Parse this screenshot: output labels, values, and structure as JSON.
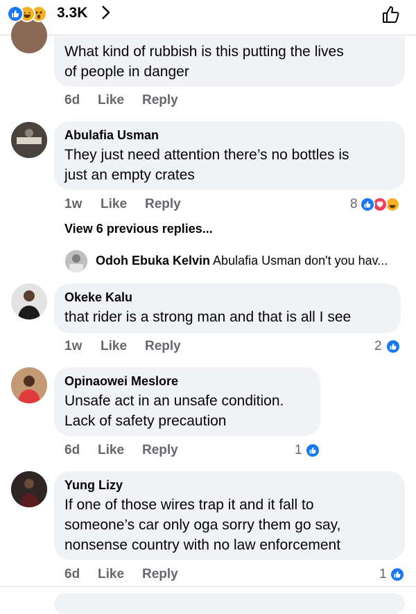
{
  "header": {
    "reaction_count": "3.3K",
    "reactions": [
      "like-icon",
      "haha-icon",
      "wow-icon"
    ]
  },
  "comments": [
    {
      "name": "",
      "text_lines": [
        "What kind of rubbish is this putting the lives",
        "of people in danger"
      ],
      "time": "6d",
      "like": "Like",
      "reply": "Reply",
      "reactions_count": ""
    },
    {
      "name": "Abulafia Usman",
      "text_lines": [
        "They just need attention there’s no bottles is",
        "just an empty crates"
      ],
      "time": "1w",
      "like": "Like",
      "reply": "Reply",
      "reactions_count": "8",
      "reactions": [
        "like-icon",
        "love-icon",
        "haha-icon"
      ],
      "view_previous": "View 6 previous replies...",
      "latest_reply": {
        "name": "Odoh Ebuka Kelvin",
        "text": "Abulafia Usman don't you hav..."
      }
    },
    {
      "name": "Okeke Kalu",
      "text_lines": [
        "that rider is a strong man and that is all I see"
      ],
      "time": "1w",
      "like": "Like",
      "reply": "Reply",
      "reactions_count": "2",
      "reactions": [
        "like-icon"
      ]
    },
    {
      "name": "Opinaowei Meslore",
      "text_lines": [
        "Unsafe act in an unsafe condition.",
        "Lack of safety precaution"
      ],
      "time": "6d",
      "like": "Like",
      "reply": "Reply",
      "reactions_count": "1",
      "reactions": [
        "like-icon"
      ]
    },
    {
      "name": "Yung Lizy",
      "text_lines": [
        "If one of those wires trap it and it fall to",
        "someone’s car only oga sorry them go say,",
        "nonsense country with no law enforcement"
      ],
      "time": "6d",
      "like": "Like",
      "reply": "Reply",
      "reactions_count": "1",
      "reactions": [
        "like-icon"
      ]
    }
  ],
  "colors": {
    "like_blue": "#1877f2",
    "love_red": "#f33e58",
    "haha_yellow": "#f7b125",
    "bubble": "#f0f2f5",
    "meta_grey": "#65676b"
  }
}
